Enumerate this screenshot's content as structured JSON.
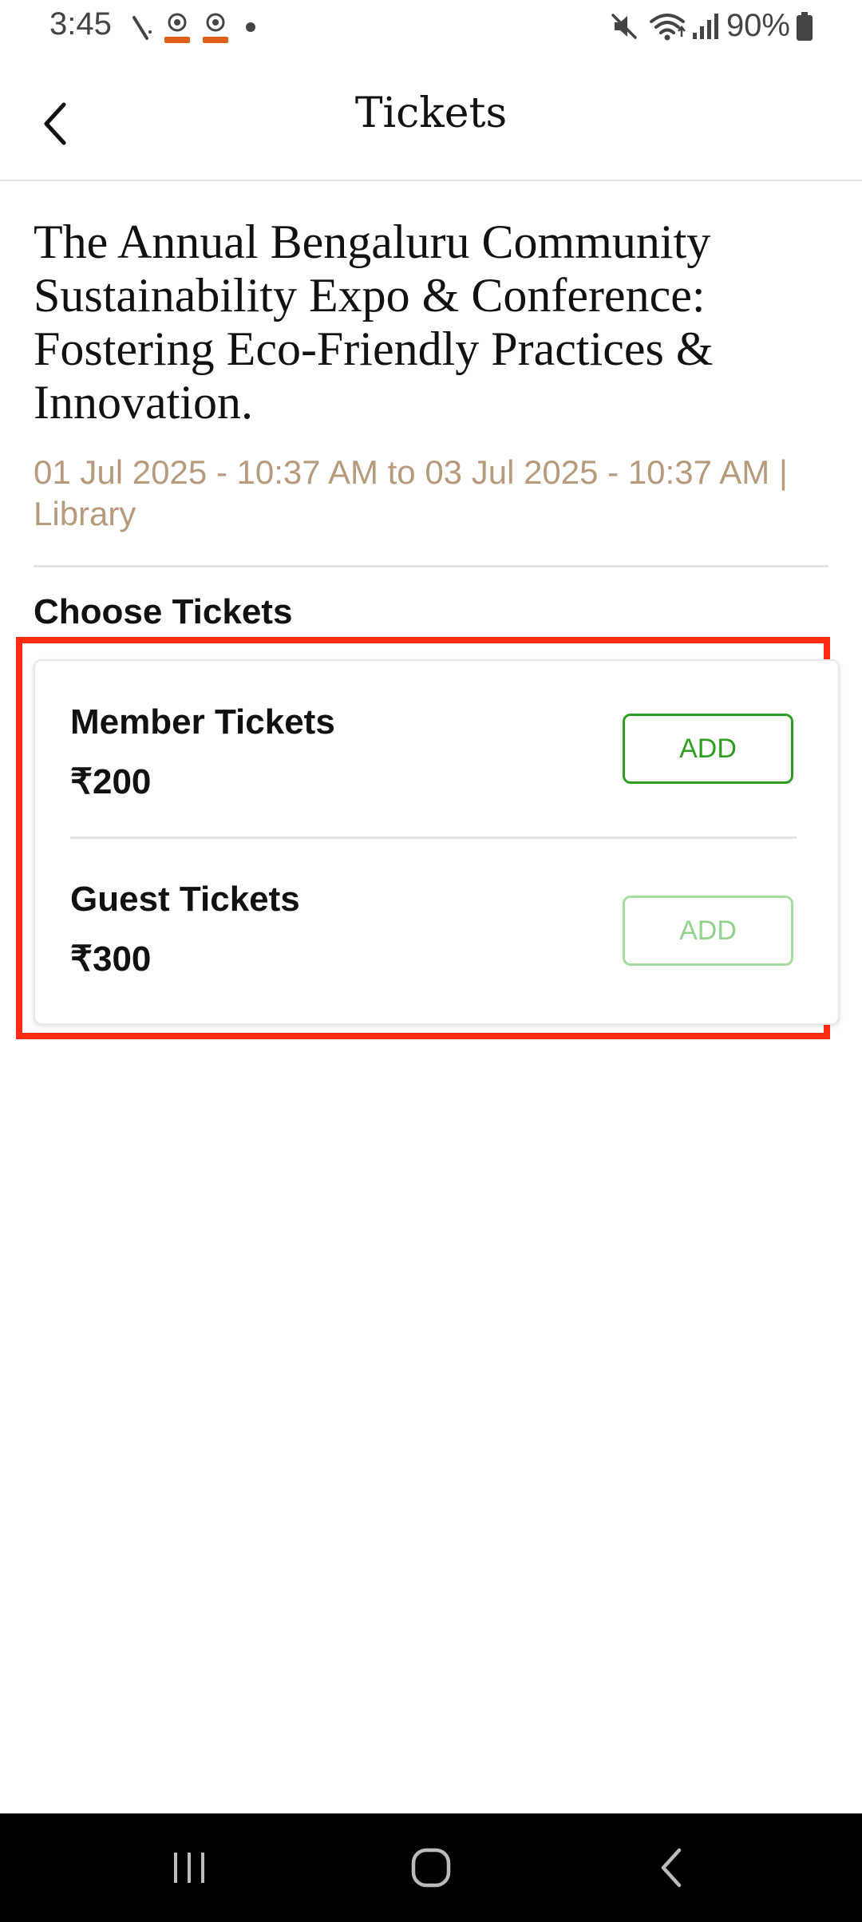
{
  "status_bar": {
    "time": "3:45",
    "battery": "90%",
    "icons": [
      "missed-call-icon",
      "app-notification-icon",
      "app-notification-icon",
      "notification-dot-icon",
      "mute-icon",
      "wifi-icon",
      "signal-icon",
      "battery-icon"
    ]
  },
  "header": {
    "title": "Tickets",
    "back_icon": "chevron-left-icon"
  },
  "event": {
    "title": "The Annual Bengaluru Community Sustainability Expo & Conference: Fostering Eco-Friendly Practices & Innovation.",
    "meta": "01 Jul 2025 - 10:37 AM to 03 Jul 2025 - 10:37 AM  |  Library"
  },
  "tickets": {
    "section_title": "Choose Tickets",
    "items": [
      {
        "name": "Member Tickets",
        "price": "₹200",
        "add_label": "ADD"
      },
      {
        "name": "Guest Tickets",
        "price": "₹300",
        "add_label": "ADD"
      }
    ]
  },
  "nav_bar": {
    "buttons": [
      "recent-apps-icon",
      "home-icon",
      "back-icon"
    ]
  },
  "colors": {
    "accent_green": "#2e9e1e",
    "meta_text": "#b59a7c",
    "highlight_red": "#ff2a12"
  }
}
